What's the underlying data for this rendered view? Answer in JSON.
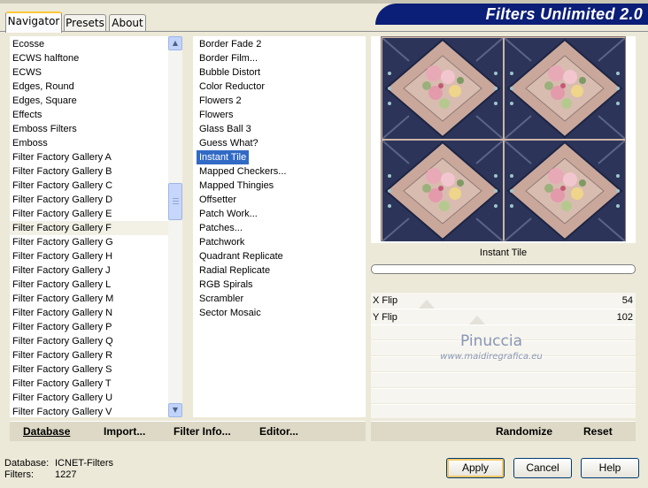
{
  "app_title": "Filters Unlimited 2.0",
  "tabs": [
    {
      "label": "Navigator"
    },
    {
      "label": "Presets"
    },
    {
      "label": "About"
    }
  ],
  "categories": [
    "Ecosse",
    "ECWS halftone",
    "ECWS",
    "Edges, Round",
    "Edges, Square",
    "Effects",
    "Emboss Filters",
    "Emboss",
    "Filter Factory Gallery A",
    "Filter Factory Gallery B",
    "Filter Factory Gallery C",
    "Filter Factory Gallery D",
    "Filter Factory Gallery E",
    "Filter Factory Gallery F",
    "Filter Factory Gallery G",
    "Filter Factory Gallery H",
    "Filter Factory Gallery J",
    "Filter Factory Gallery L",
    "Filter Factory Gallery M",
    "Filter Factory Gallery N",
    "Filter Factory Gallery P",
    "Filter Factory Gallery Q",
    "Filter Factory Gallery R",
    "Filter Factory Gallery S",
    "Filter Factory Gallery T",
    "Filter Factory Gallery U",
    "Filter Factory Gallery V"
  ],
  "selected_category": "Filter Factory Gallery F",
  "filters": [
    "Border Fade 2",
    "Border Film...",
    "Bubble Distort",
    "Color Reductor",
    "Flowers 2",
    "Flowers",
    "Glass Ball 3",
    "Guess What?",
    "Instant Tile",
    "Mapped Checkers...",
    "Mapped Thingies",
    "Offsetter",
    "Patch Work...",
    "Patches...",
    "Patchwork",
    "Quadrant Replicate",
    "Radial Replicate",
    "RGB Spirals",
    "Scrambler",
    "Sector Mosaic"
  ],
  "selected_filter": "Instant Tile",
  "left_actions": {
    "database": "Database",
    "import": "Import...",
    "filter_info": "Filter Info...",
    "editor": "Editor..."
  },
  "right_actions": {
    "randomize": "Randomize",
    "reset": "Reset"
  },
  "preview": {
    "filter_name": "Instant Tile",
    "progress": 0
  },
  "sliders": [
    {
      "label": "X Flip",
      "value": "54"
    },
    {
      "label": "Y Flip",
      "value": "102"
    }
  ],
  "watermark": {
    "name": "Pinuccia",
    "url": "www.maidiregrafica.eu"
  },
  "status": {
    "database_label": "Database:",
    "database_value": "ICNET-Filters",
    "filters_label": "Filters:",
    "filters_value": "1227"
  },
  "buttons": {
    "apply": "Apply",
    "cancel": "Cancel",
    "help": "Help"
  },
  "colors": {
    "banner": "#0b1e78",
    "selection": "#316ac5",
    "tile_navy": "#2c3559",
    "tile_rose": "#c9a89b"
  }
}
